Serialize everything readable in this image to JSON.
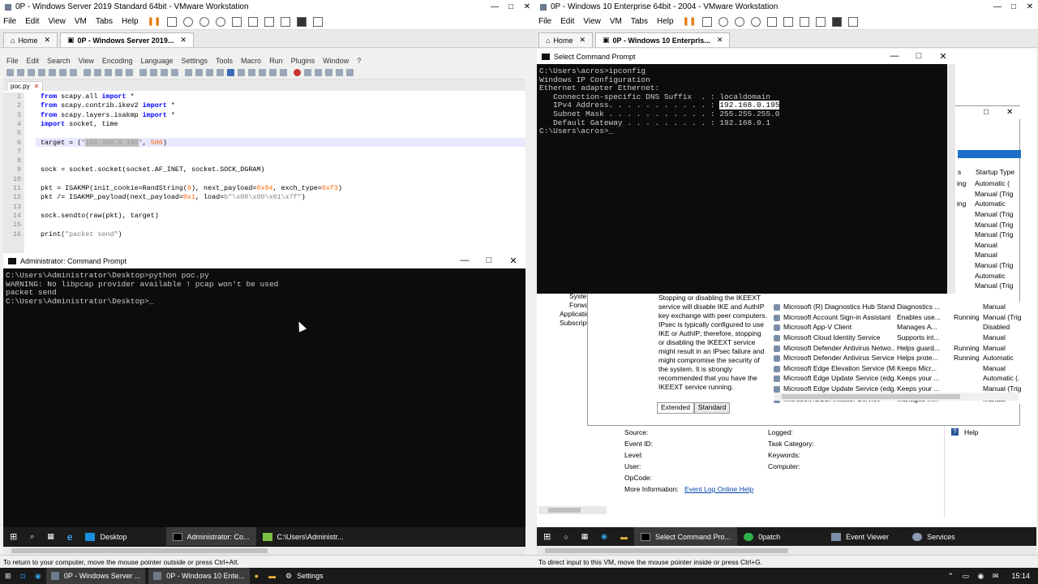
{
  "left": {
    "title": "0P - Windows Server 2019 Standard 64bit - VMware Workstation",
    "menu": [
      "File",
      "Edit",
      "View",
      "VM",
      "Tabs",
      "Help"
    ],
    "tabs": [
      {
        "label": "Home"
      },
      {
        "label": "0P - Windows Server 2019..."
      }
    ],
    "notepad": {
      "menu": [
        "File",
        "Edit",
        "Search",
        "View",
        "Encoding",
        "Language",
        "Settings",
        "Tools",
        "Macro",
        "Run",
        "Plugins",
        "Window",
        "?"
      ],
      "file_tab": "poc.py",
      "line_numbers": [
        "1",
        "2",
        "3",
        "4",
        "5",
        "6",
        "7",
        "8",
        "9",
        "10",
        "11",
        "12",
        "13",
        "14",
        "15",
        "16"
      ]
    },
    "cmd": {
      "title": "Administrator: Command Prompt",
      "lines": [
        "C:\\Users\\Administrator\\Desktop>python poc.py",
        "WARNING: No libpcap provider available ! pcap won't be used",
        "packet send",
        "",
        "C:\\Users\\Administrator\\Desktop>"
      ]
    },
    "taskbar": [
      {
        "label": "Desktop"
      },
      {
        "label": "Administrator: Co..."
      },
      {
        "label": "C:\\Users\\Administr..."
      }
    ],
    "status": "To return to your computer, move the mouse pointer outside or press Ctrl+Alt."
  },
  "right": {
    "title": "0P - Windows 10 Enterprise 64bit - 2004 - VMware Workstation",
    "menu": [
      "File",
      "Edit",
      "View",
      "VM",
      "Tabs",
      "Help"
    ],
    "tabs": [
      {
        "label": "Home"
      },
      {
        "label": "0P - Windows 10 Enterpris..."
      }
    ],
    "cmd": {
      "title": "Select Command Prompt",
      "lines": [
        "C:\\Users\\acros>ipconfig",
        "",
        "Windows IP Configuration",
        "",
        "",
        "Ethernet adapter Ethernet:",
        "",
        "   Connection-specific DNS Suffix  . : localdomain",
        "   IPv4 Address. . . . . . . . . . . : ",
        "   Subnet Mask . . . . . . . . . . . : 255.255.255.0",
        "   Default Gateway . . . . . . . . . : 192.168.0.1",
        "",
        "C:\\Users\\acros>"
      ],
      "ipv4": "192.168.0.195"
    },
    "services": {
      "header_status": "s",
      "header_startup": "Startup Type",
      "top_rows": [
        {
          "status": "ing",
          "startup": "Automatic ("
        },
        {
          "status": "",
          "startup": "Manual (Trig"
        },
        {
          "status": "ing",
          "startup": "Automatic"
        },
        {
          "status": "",
          "startup": "Manual (Trig"
        },
        {
          "status": "",
          "startup": "Manual (Trig"
        },
        {
          "status": "",
          "startup": "Manual (Trig"
        },
        {
          "status": "",
          "startup": "Manual"
        },
        {
          "status": "",
          "startup": "Manual"
        },
        {
          "status": "",
          "startup": "Manual (Trig"
        },
        {
          "status": "",
          "startup": "Automatic"
        },
        {
          "status": "",
          "startup": "Manual (Trig"
        }
      ],
      "rows": [
        {
          "name": "Microsoft (R) Diagnostics Hub Stand...",
          "desc": "Diagnostics ...",
          "status": "",
          "startup": "Manual"
        },
        {
          "name": "Microsoft Account Sign-in Assistant",
          "desc": "Enables use...",
          "status": "Running",
          "startup": "Manual (Trig"
        },
        {
          "name": "Microsoft App-V Client",
          "desc": "Manages A...",
          "status": "",
          "startup": "Disabled"
        },
        {
          "name": "Microsoft Cloud Identity Service",
          "desc": "Supports int...",
          "status": "",
          "startup": "Manual"
        },
        {
          "name": "Microsoft Defender Antivirus Netwo...",
          "desc": "Helps guard...",
          "status": "Running",
          "startup": "Manual"
        },
        {
          "name": "Microsoft Defender Antivirus Service",
          "desc": "Helps prote...",
          "status": "Running",
          "startup": "Automatic"
        },
        {
          "name": "Microsoft Edge Elevation Service (Mi...",
          "desc": "Keeps Micr...",
          "status": "",
          "startup": "Manual"
        },
        {
          "name": "Microsoft Edge Update Service (edg...",
          "desc": "Keeps your ...",
          "status": "",
          "startup": "Automatic (."
        },
        {
          "name": "Microsoft Edge Update Service (edg...",
          "desc": "Keeps your ...",
          "status": "",
          "startup": "Manual (Trig"
        },
        {
          "name": "Microsoft iSCSI Initiator Service",
          "desc": "Manages In...",
          "status": "",
          "startup": "Manual"
        }
      ],
      "description": "Stopping or disabling the IKEEXT service will disable IKE and AuthIP key exchange with peer computers. IPsec is typically configured to use IKE or AuthIP; therefore, stopping or disabling the IKEEXT service might result in an IPsec failure and might compromise the security of the system. It is strongly recommended that you have the IKEEXT service running.",
      "tab_extended": "Extended",
      "tab_standard": "Standard"
    },
    "tree": [
      "Syste",
      "Forwa",
      "Applicatio",
      "Subscripti"
    ],
    "event": {
      "source": "Source:",
      "event_id": "Event ID:",
      "level": "Level:",
      "user": "User:",
      "opcode": "OpCode:",
      "more_info": "More Information:",
      "link": "Event Log Online Help",
      "logged": "Logged:",
      "task": "Task Category:",
      "keywords": "Keywords:",
      "computer": "Computer:",
      "help": "Help"
    },
    "taskbar": [
      {
        "label": "Select Command Pro..."
      },
      {
        "label": "0patch"
      },
      {
        "label": "Event Viewer"
      },
      {
        "label": "Services"
      }
    ],
    "status": "To direct input to this VM, move the mouse pointer inside or press Ctrl+G."
  },
  "host": {
    "tasks": [
      {
        "label": "0P - Windows Server ..."
      },
      {
        "label": "0P - Windows 10 Ente..."
      },
      {
        "label": "Settings"
      }
    ],
    "clock": "15:14"
  },
  "colors": {
    "vmware_accent": "#e5780c",
    "cmd_bg": "#0c0c0c",
    "cmd_fg": "#cccccc"
  }
}
